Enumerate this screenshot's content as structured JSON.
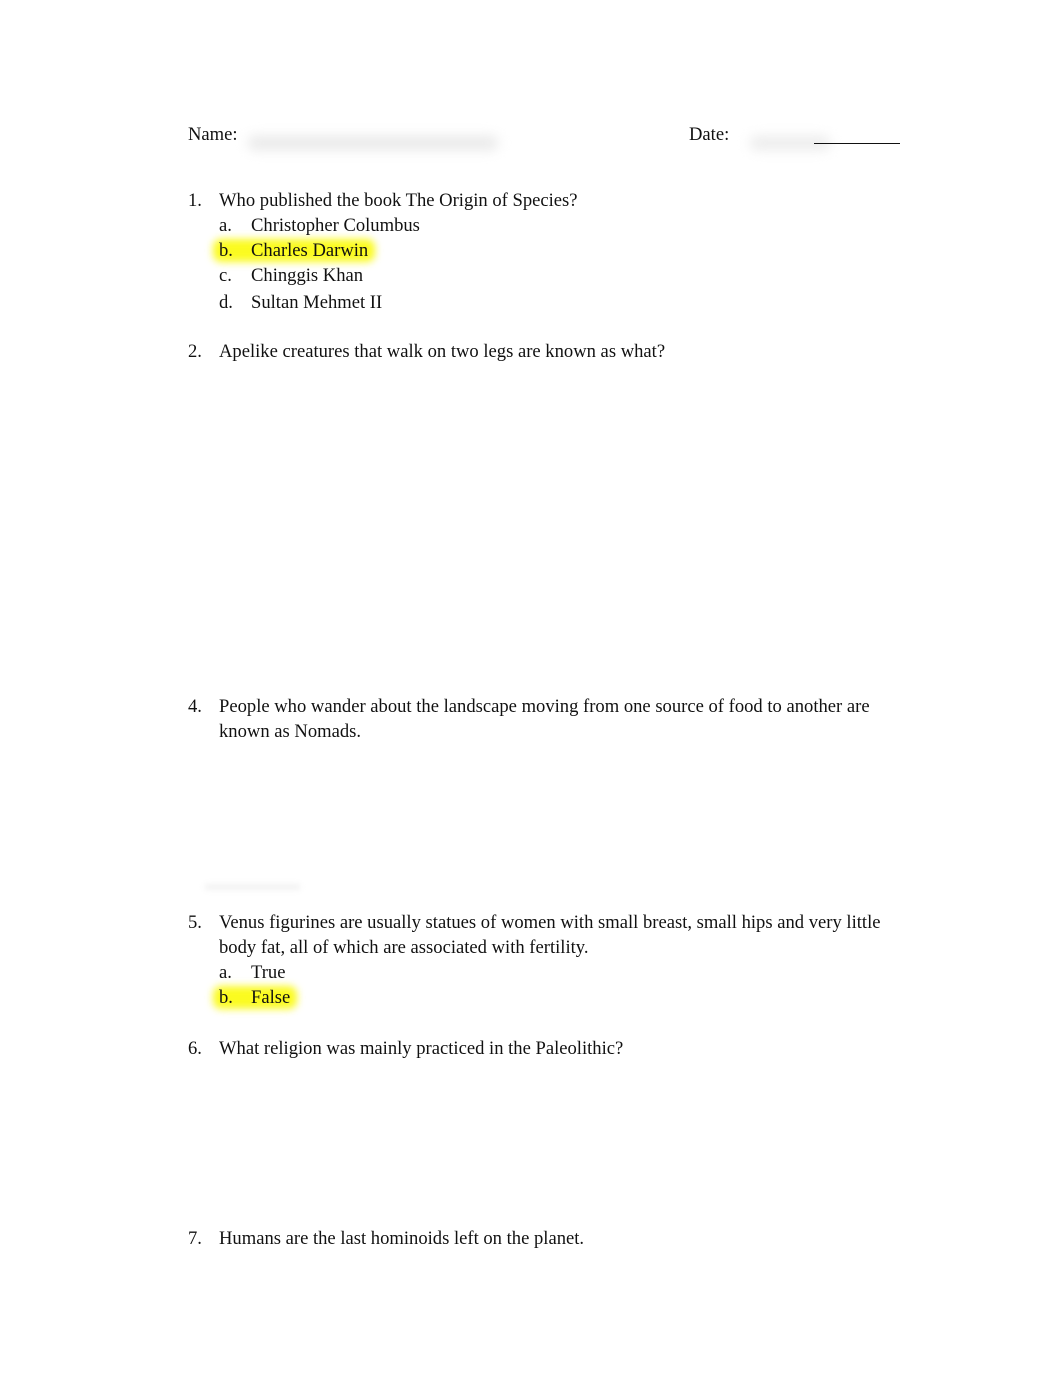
{
  "header": {
    "name_label": "Name:",
    "date_label": "Date:"
  },
  "highlight_color": "#FBFB20",
  "questions": [
    {
      "number": "1.",
      "text": "Who published the book  The Origin of Species?",
      "options": [
        {
          "letter": "a.",
          "text": "Christopher Columbus",
          "highlighted": false
        },
        {
          "letter": "b.",
          "text": "Charles Darwin",
          "highlighted": true
        },
        {
          "letter": "c.",
          "text": "Chinggis Khan",
          "highlighted": false
        },
        {
          "letter": "d.",
          "text": "Sultan Mehmet II",
          "highlighted": false
        }
      ]
    },
    {
      "number": "2.",
      "text": "Apelike creatures that walk on two legs are known as what?",
      "options": []
    },
    {
      "number": "4.",
      "text": "People who wander about the landscape moving from one source of food to another are known as Nomads.",
      "options": []
    },
    {
      "number": "5.",
      "text": "Venus figurines are usually statues of women with small breast, small hips and very little body fat, all of which are associated with fertility.",
      "options": [
        {
          "letter": "a.",
          "text": "True",
          "highlighted": false
        },
        {
          "letter": "b.",
          "text": "False",
          "highlighted": true
        }
      ]
    },
    {
      "number": "6.",
      "text": "What religion was mainly practiced in the Paleolithic?",
      "options": []
    },
    {
      "number": "7.",
      "text": "Humans are the last hominoids left on the planet.",
      "options": []
    }
  ]
}
